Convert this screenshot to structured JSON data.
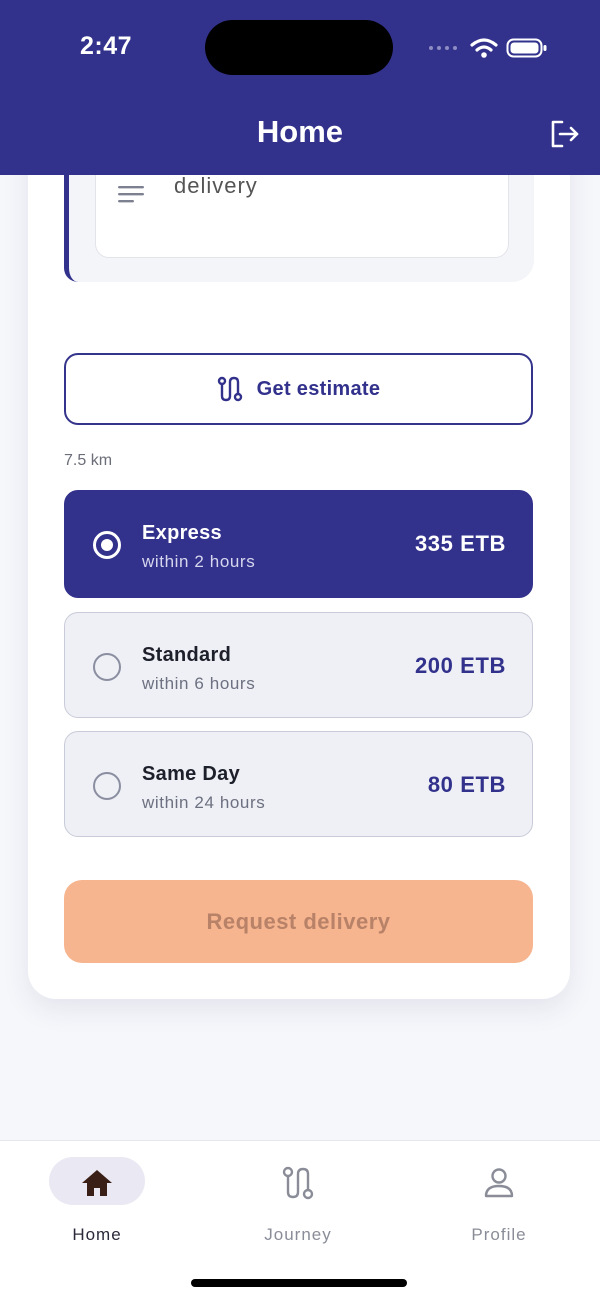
{
  "status_bar": {
    "time": "2:47"
  },
  "header": {
    "title": "Home"
  },
  "description": {
    "value": "delivery"
  },
  "estimate_button": {
    "label": "Get estimate"
  },
  "distance": "7.5 km",
  "options": [
    {
      "name": "Express",
      "eta": "within 2 hours",
      "price": "335 ETB",
      "selected": true
    },
    {
      "name": "Standard",
      "eta": "within 6 hours",
      "price": "200 ETB",
      "selected": false
    },
    {
      "name": "Same Day",
      "eta": "within 24 hours",
      "price": "80 ETB",
      "selected": false
    }
  ],
  "request_button": {
    "label": "Request delivery"
  },
  "bottom_nav": [
    {
      "label": "Home",
      "icon": "home-icon",
      "active": true
    },
    {
      "label": "Journey",
      "icon": "route-icon",
      "active": false
    },
    {
      "label": "Profile",
      "icon": "user-icon",
      "active": false
    }
  ],
  "colors": {
    "primary": "#32318c",
    "option_background": "#eef0f5",
    "request_button": "#f6b48f",
    "request_text": "#b78268"
  }
}
